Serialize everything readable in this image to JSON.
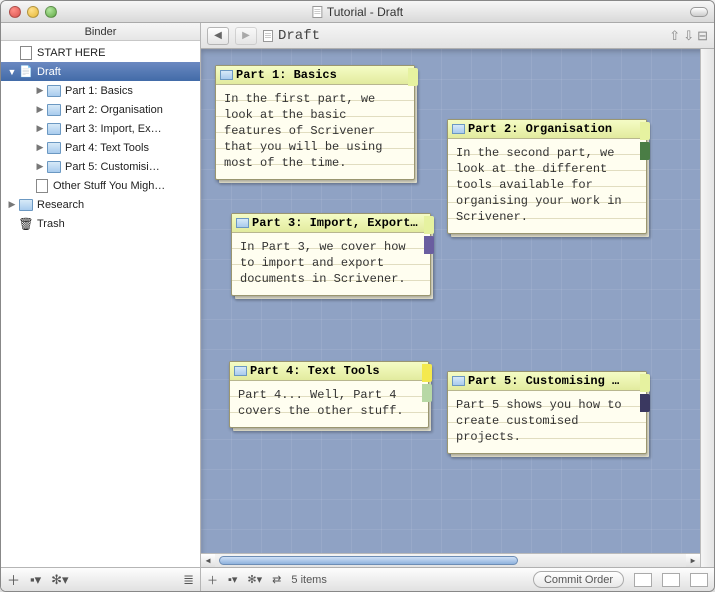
{
  "window": {
    "title": "Tutorial - Draft"
  },
  "binder": {
    "header": "Binder",
    "items": [
      {
        "label": "START HERE"
      },
      {
        "label": "Draft"
      },
      {
        "label": "Part 1: Basics"
      },
      {
        "label": "Part 2: Organisation"
      },
      {
        "label": "Part 3: Import, Ex…"
      },
      {
        "label": "Part 4: Text Tools"
      },
      {
        "label": "Part 5: Customisi…"
      },
      {
        "label": "Other Stuff You Migh…"
      },
      {
        "label": "Research"
      },
      {
        "label": "Trash"
      }
    ]
  },
  "nav": {
    "breadcrumb": "Draft"
  },
  "cards": [
    {
      "title": "Part 1: Basics",
      "body": "In the first part, we look at the basic features of Scrivener that you will be using most of the time."
    },
    {
      "title": "Part 2: Organisation",
      "body": "In the second part, we look at the different tools available for organising your work in Scrivener."
    },
    {
      "title": "Part 3: Import, Export…",
      "body": "In Part 3, we cover how to import and export documents in Scrivener."
    },
    {
      "title": "Part 4: Text Tools",
      "body": "Part 4... Well, Part 4 covers the other stuff."
    },
    {
      "title": "Part 5: Customising …",
      "body": "Part 5 shows you how to create customised projects."
    }
  ],
  "footer": {
    "count": "5 items",
    "commit": "Commit Order"
  }
}
